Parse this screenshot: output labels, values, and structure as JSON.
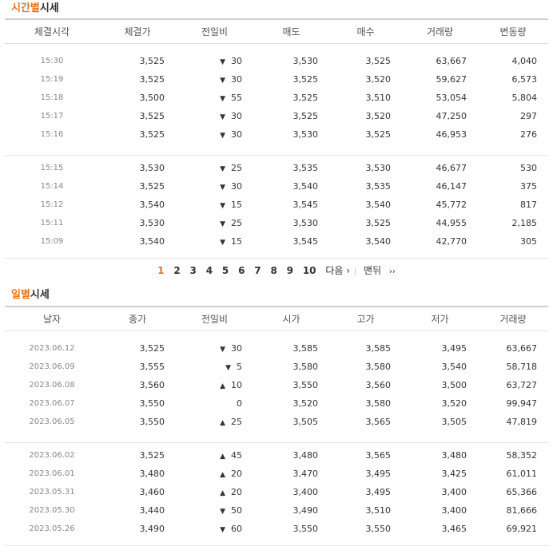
{
  "time_section": {
    "title_hl": "시간별",
    "title_rest": "시세",
    "headers": [
      "체결시각",
      "체결가",
      "전일비",
      "매도",
      "매수",
      "거래량",
      "변동량"
    ],
    "group1": [
      {
        "time": "15:30",
        "price": "3,525",
        "dir": "down",
        "chg": "30",
        "ask": "3,530",
        "bid": "3,525",
        "vol": "63,667",
        "delta": "4,040"
      },
      {
        "time": "15:19",
        "price": "3,525",
        "dir": "down",
        "chg": "30",
        "ask": "3,525",
        "bid": "3,520",
        "vol": "59,627",
        "delta": "6,573"
      },
      {
        "time": "15:18",
        "price": "3,500",
        "dir": "down",
        "chg": "55",
        "ask": "3,525",
        "bid": "3,510",
        "vol": "53,054",
        "delta": "5,804"
      },
      {
        "time": "15:17",
        "price": "3,525",
        "dir": "down",
        "chg": "30",
        "ask": "3,525",
        "bid": "3,520",
        "vol": "47,250",
        "delta": "297"
      },
      {
        "time": "15:16",
        "price": "3,525",
        "dir": "down",
        "chg": "30",
        "ask": "3,530",
        "bid": "3,525",
        "vol": "46,953",
        "delta": "276"
      }
    ],
    "group2": [
      {
        "time": "15:15",
        "price": "3,530",
        "dir": "down",
        "chg": "25",
        "ask": "3,535",
        "bid": "3,530",
        "vol": "46,677",
        "delta": "530"
      },
      {
        "time": "15:14",
        "price": "3,525",
        "dir": "down",
        "chg": "30",
        "ask": "3,540",
        "bid": "3,535",
        "vol": "46,147",
        "delta": "375"
      },
      {
        "time": "15:12",
        "price": "3,540",
        "dir": "down",
        "chg": "15",
        "ask": "3,545",
        "bid": "3,540",
        "vol": "45,772",
        "delta": "817"
      },
      {
        "time": "15:11",
        "price": "3,530",
        "dir": "down",
        "chg": "25",
        "ask": "3,530",
        "bid": "3,525",
        "vol": "44,955",
        "delta": "2,185"
      },
      {
        "time": "15:09",
        "price": "3,540",
        "dir": "down",
        "chg": "15",
        "ask": "3,545",
        "bid": "3,540",
        "vol": "42,770",
        "delta": "305"
      }
    ]
  },
  "pager": {
    "current": "1",
    "pages": [
      "2",
      "3",
      "4",
      "5",
      "6",
      "7",
      "8",
      "9",
      "10"
    ],
    "next_label": "다음",
    "last_label": "맨뒤",
    "next_glyph": "›",
    "last_glyph": "››"
  },
  "day_section": {
    "title_hl": "일별",
    "title_rest": "시세",
    "headers": [
      "날자",
      "종가",
      "전일비",
      "시가",
      "고가",
      "저가",
      "거래량"
    ],
    "group1": [
      {
        "date": "2023.06.12",
        "close": "3,525",
        "dir": "down",
        "chg": "30",
        "open": "3,585",
        "high": "3,585",
        "low": "3,495",
        "vol": "63,667"
      },
      {
        "date": "2023.06.09",
        "close": "3,555",
        "dir": "down",
        "chg": "5",
        "open": "3,580",
        "high": "3,580",
        "low": "3,540",
        "vol": "58,718"
      },
      {
        "date": "2023.06.08",
        "close": "3,560",
        "dir": "up",
        "chg": "10",
        "open": "3,550",
        "high": "3,560",
        "low": "3,500",
        "vol": "63,727"
      },
      {
        "date": "2023.06.07",
        "close": "3,550",
        "dir": "flat",
        "chg": "0",
        "open": "3,520",
        "high": "3,580",
        "low": "3,520",
        "vol": "99,947"
      },
      {
        "date": "2023.06.05",
        "close": "3,550",
        "dir": "up",
        "chg": "25",
        "open": "3,505",
        "high": "3,565",
        "low": "3,505",
        "vol": "47,819"
      }
    ],
    "group2": [
      {
        "date": "2023.06.02",
        "close": "3,525",
        "dir": "up",
        "chg": "45",
        "open": "3,480",
        "high": "3,565",
        "low": "3,480",
        "vol": "58,352"
      },
      {
        "date": "2023.06.01",
        "close": "3,480",
        "dir": "up",
        "chg": "20",
        "open": "3,470",
        "high": "3,495",
        "low": "3,425",
        "vol": "61,011"
      },
      {
        "date": "2023.05.31",
        "close": "3,460",
        "dir": "up",
        "chg": "20",
        "open": "3,400",
        "high": "3,495",
        "low": "3,400",
        "vol": "65,366"
      },
      {
        "date": "2023.05.30",
        "close": "3,440",
        "dir": "down",
        "chg": "50",
        "open": "3,490",
        "high": "3,510",
        "low": "3,400",
        "vol": "81,666"
      },
      {
        "date": "2023.05.26",
        "close": "3,490",
        "dir": "down",
        "chg": "60",
        "open": "3,550",
        "high": "3,550",
        "low": "3,465",
        "vol": "69,921"
      }
    ]
  },
  "symbols": {
    "down": "▼",
    "up": "▲",
    "flat": ""
  },
  "colors": {
    "accent": "#e8741a",
    "down": "#1e63c8",
    "up": "#d01e1e"
  }
}
